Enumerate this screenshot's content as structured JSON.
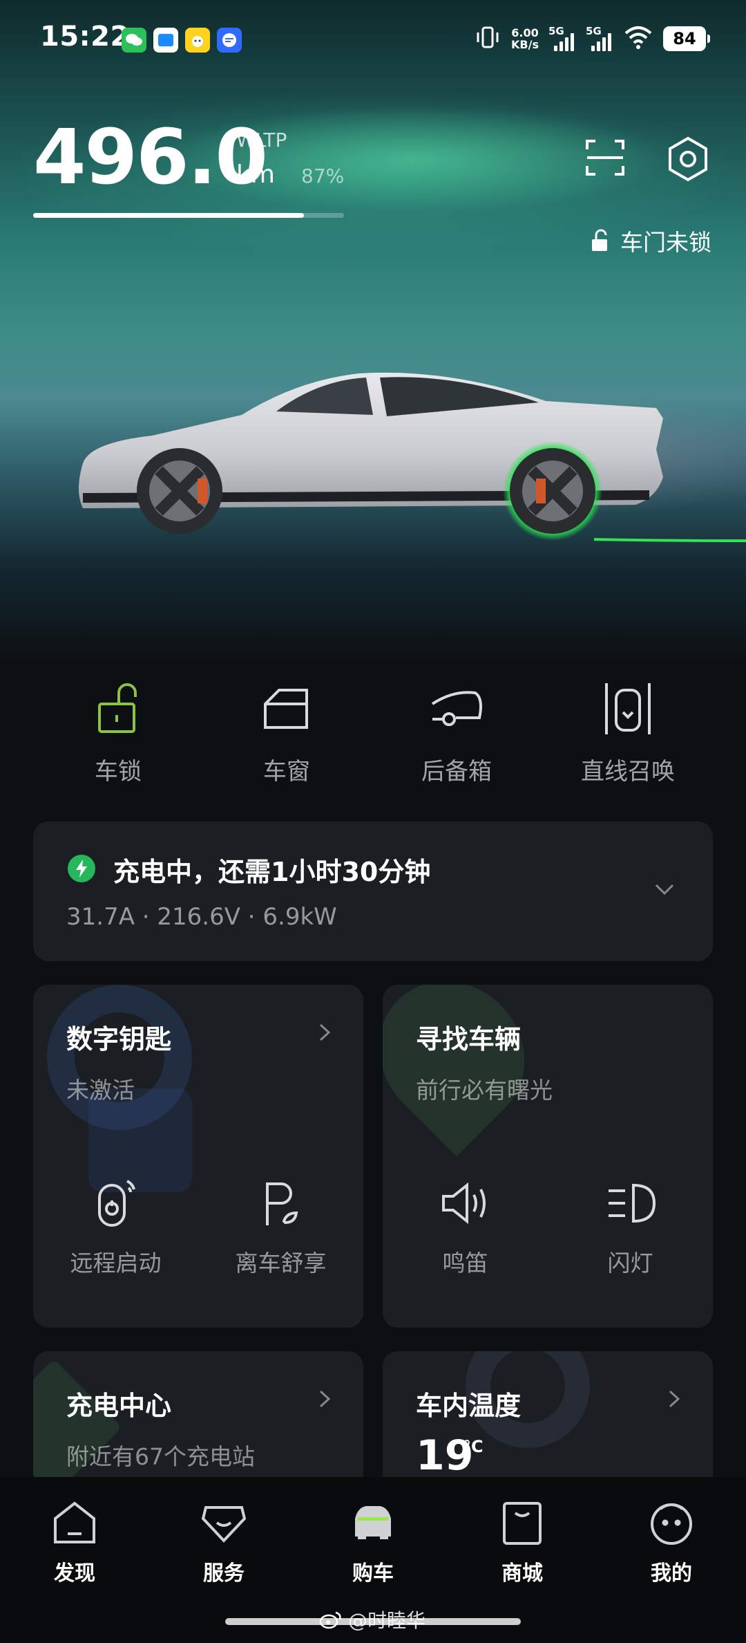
{
  "status_bar": {
    "time": "15:22",
    "net_speed_value": "6.00",
    "net_speed_unit": "KB/s",
    "sim1": "5G",
    "sim2": "5G",
    "battery": "84",
    "app_icons": [
      "wechat-icon",
      "app-blue-icon",
      "app-yellow-icon",
      "app-messenger-icon"
    ]
  },
  "range": {
    "value": "496.0",
    "standard": "WLTP",
    "unit": "km",
    "percent": "87%",
    "fill_fraction": 0.87
  },
  "header_icons": [
    "scan-icon",
    "settings-icon"
  ],
  "door_status": "车门未锁",
  "quick_controls": [
    {
      "label": "车锁",
      "icon": "unlock-icon"
    },
    {
      "label": "车窗",
      "icon": "window-icon"
    },
    {
      "label": "后备箱",
      "icon": "trunk-icon"
    },
    {
      "label": "直线召唤",
      "icon": "summon-icon"
    }
  ],
  "charging": {
    "title": "充电中，还需1小时30分钟",
    "detail": "31.7A · 216.6V · 6.9kW"
  },
  "digital_key": {
    "title": "数字钥匙",
    "subtitle": "未激活",
    "actions": [
      {
        "label": "远程启动",
        "icon": "remote-start-icon"
      },
      {
        "label": "离车舒享",
        "icon": "parking-comfort-icon"
      }
    ]
  },
  "find_vehicle": {
    "title": "寻找车辆",
    "subtitle": "前行必有曙光",
    "actions": [
      {
        "label": "鸣笛",
        "icon": "horn-icon"
      },
      {
        "label": "闪灯",
        "icon": "headlight-icon"
      }
    ]
  },
  "charging_center": {
    "title": "充电中心",
    "subtitle": "附近有67个充电站"
  },
  "cabin_temp": {
    "title": "车内温度",
    "value": "19",
    "unit": "°C"
  },
  "bottom_nav": [
    {
      "label": "发现",
      "icon": "discover-icon"
    },
    {
      "label": "服务",
      "icon": "service-icon"
    },
    {
      "label": "购车",
      "icon": "car-icon"
    },
    {
      "label": "商城",
      "icon": "shop-icon"
    },
    {
      "label": "我的",
      "icon": "profile-icon"
    }
  ],
  "watermark": "@时睦华",
  "colors": {
    "accent_green": "#27b85e",
    "lock_green": "#8fc14a",
    "card_bg": "#1b1e22",
    "page_bg": "#0d1013"
  }
}
